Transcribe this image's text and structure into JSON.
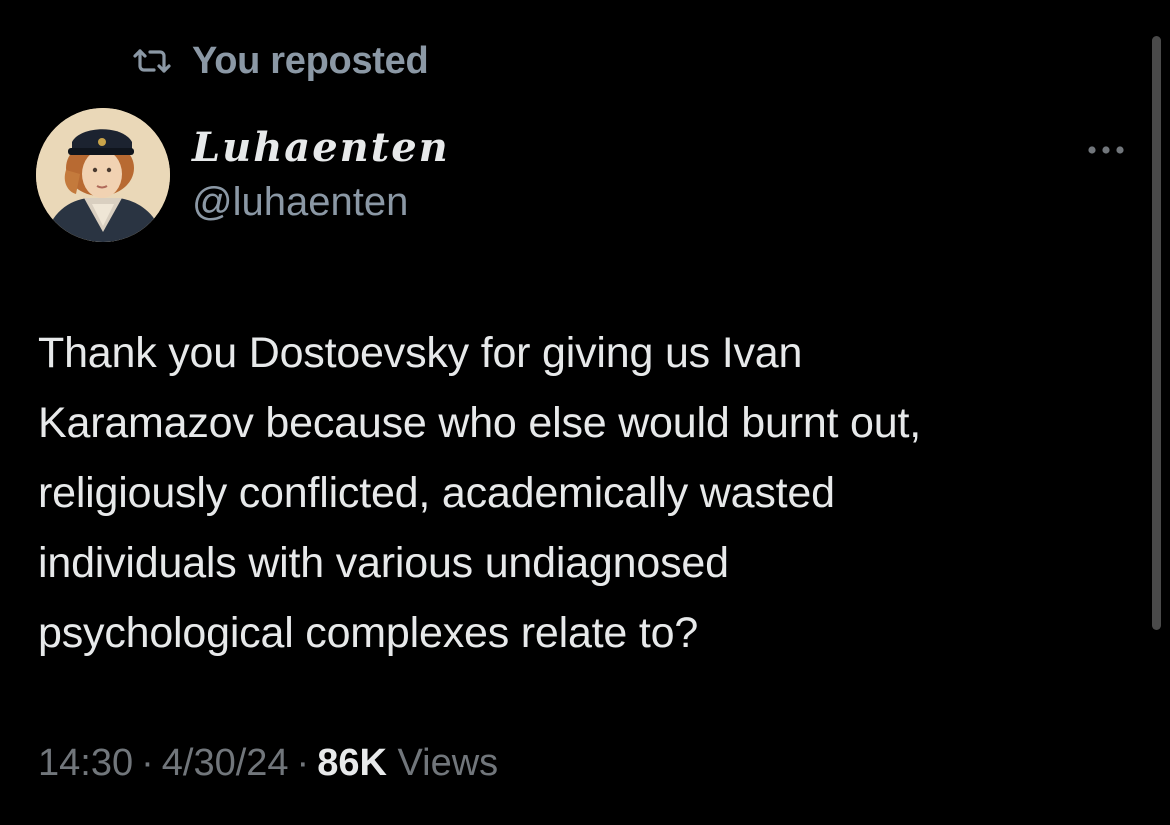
{
  "repost": {
    "icon": "repost-icon",
    "label": "You reposted"
  },
  "author": {
    "display_name": "Luhaenten",
    "handle": "@luhaenten",
    "avatar": "avatar-portrait"
  },
  "menu": {
    "icon": "more-options-icon"
  },
  "tweet": {
    "lines": [
      "Thank you Dostoevsky for giving us Ivan",
      "Karamazov because who else would burnt out,",
      "religiously conflicted, academically wasted",
      "individuals with various undiagnosed",
      "psychological complexes relate to?"
    ]
  },
  "meta": {
    "time": "14:30",
    "separator": "·",
    "date": "4/30/24",
    "views_count": "86K",
    "views_label": "Views"
  },
  "colors": {
    "background": "#000000",
    "primary_text": "#e7e9ea",
    "secondary_text": "#71767b"
  }
}
